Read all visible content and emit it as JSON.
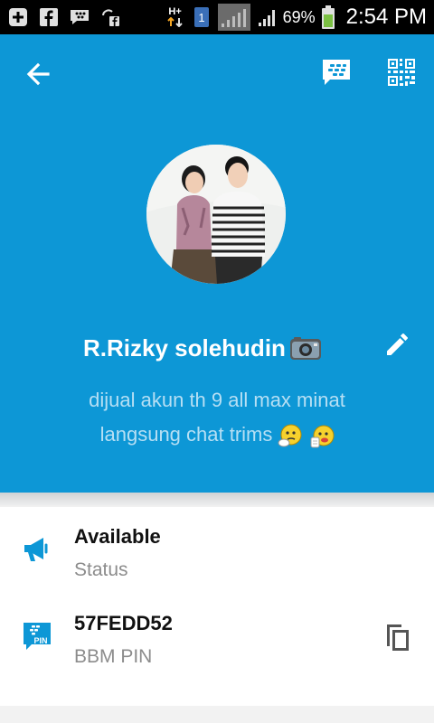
{
  "status_bar": {
    "battery_percent": "69%",
    "time": "2:54 PM",
    "network_label": "H+",
    "sim_badge": "1",
    "icons": [
      "add-box-icon",
      "facebook-icon",
      "bbm-chat-icon",
      "sync-facebook-icon",
      "data-arrows-icon",
      "sim-icon",
      "signal-icon",
      "signal-icon",
      "battery-icon"
    ]
  },
  "toolbar": {
    "back_icon": "arrow-left-icon",
    "chat_icon": "bbm-chat-icon",
    "qr_icon": "qr-code-icon"
  },
  "profile": {
    "name": "R.Rizky solehudin",
    "name_emoji": "camera-icon",
    "status_line1": "dijual akun th 9 all max minat",
    "status_line2": "langsung chat trims",
    "edit_icon": "pencil-icon"
  },
  "details": {
    "availability": {
      "title": "Available",
      "subtitle": "Status",
      "icon": "megaphone-icon"
    },
    "pin": {
      "title": "57FEDD52",
      "subtitle": "BBM PIN",
      "icon": "bbm-pin-icon",
      "icon_text": "PIN",
      "copy_icon": "copy-icon"
    }
  },
  "colors": {
    "header": "#0d97d6",
    "status_text": "#b6dff4",
    "icon_accent": "#0d97d6"
  }
}
